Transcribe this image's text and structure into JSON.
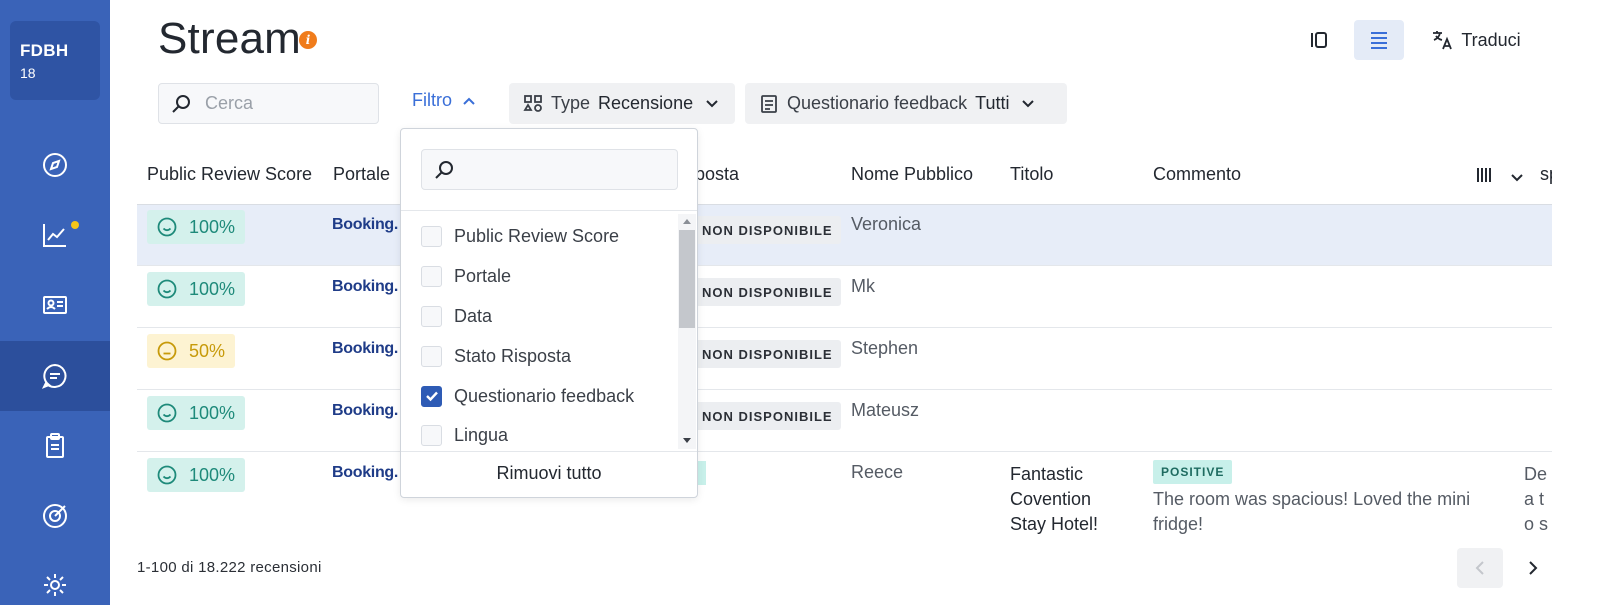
{
  "sidebar": {
    "org_name": "FDBH",
    "org_number": "18",
    "items": [
      {
        "icon": "compass-icon"
      },
      {
        "icon": "chart-trend-icon",
        "notification": true
      },
      {
        "icon": "id-card-icon"
      },
      {
        "icon": "chat-icon",
        "active": true
      },
      {
        "icon": "clipboard-icon"
      },
      {
        "icon": "target-icon"
      },
      {
        "icon": "gear-icon"
      }
    ]
  },
  "header": {
    "title": "Stream",
    "translate_label": "Traduci"
  },
  "toolbar": {
    "search_placeholder": "Cerca",
    "filter_label": "Filtro",
    "type_chip": {
      "key": "Type",
      "value": "Recensione"
    },
    "questionnaire_chip": {
      "key": "Questionario feedback",
      "value": "Tutti"
    }
  },
  "table": {
    "columns": [
      "Public Review Score",
      "Portale",
      "Risposta",
      "Nome Pubblico",
      "Titolo",
      "Commento",
      "sp"
    ],
    "rows": [
      {
        "score": "100%",
        "level": "good",
        "portal": "Booking.",
        "status": "NON DISPONIBILE",
        "name": "Veronica",
        "title": "",
        "sentiment": "",
        "comment": "",
        "response": ""
      },
      {
        "score": "100%",
        "level": "good",
        "portal": "Booking.",
        "status": "NON DISPONIBILE",
        "name": "Mk",
        "title": "",
        "sentiment": "",
        "comment": "",
        "response": ""
      },
      {
        "score": "50%",
        "level": "mid",
        "portal": "Booking.",
        "status": "NON DISPONIBILE",
        "name": "Stephen",
        "title": "",
        "sentiment": "",
        "comment": "",
        "response": ""
      },
      {
        "score": "100%",
        "level": "good",
        "portal": "Booking.",
        "status": "NON DISPONIBILE",
        "name": "Mateusz",
        "title": "",
        "sentiment": "",
        "comment": "",
        "response": ""
      },
      {
        "score": "100%",
        "level": "good",
        "portal": "Booking.",
        "status": "",
        "name": "Reece",
        "title": "Fantastic Covention Stay Hotel!",
        "sentiment": "POSITIVE",
        "comment": "The room was spacious! Loved the mini fridge!",
        "response": "Dea to s deli spa"
      }
    ]
  },
  "column_picker": {
    "search_placeholder": "",
    "options": [
      {
        "label": "Public Review Score",
        "checked": false
      },
      {
        "label": "Portale",
        "checked": false
      },
      {
        "label": "Data",
        "checked": false
      },
      {
        "label": "Stato Risposta",
        "checked": false
      },
      {
        "label": "Questionario feedback",
        "checked": true
      },
      {
        "label": "Lingua",
        "checked": false
      }
    ],
    "remove_all_label": "Rimuovi tutto"
  },
  "footer": {
    "count_text": "1-100 di 18.222 recensioni"
  },
  "colors": {
    "sidebar": "#3a63b8",
    "accent": "#3a6fd8",
    "score_good": "#1e8a7a",
    "score_mid": "#c79a0a",
    "notification": "#f5c518"
  }
}
